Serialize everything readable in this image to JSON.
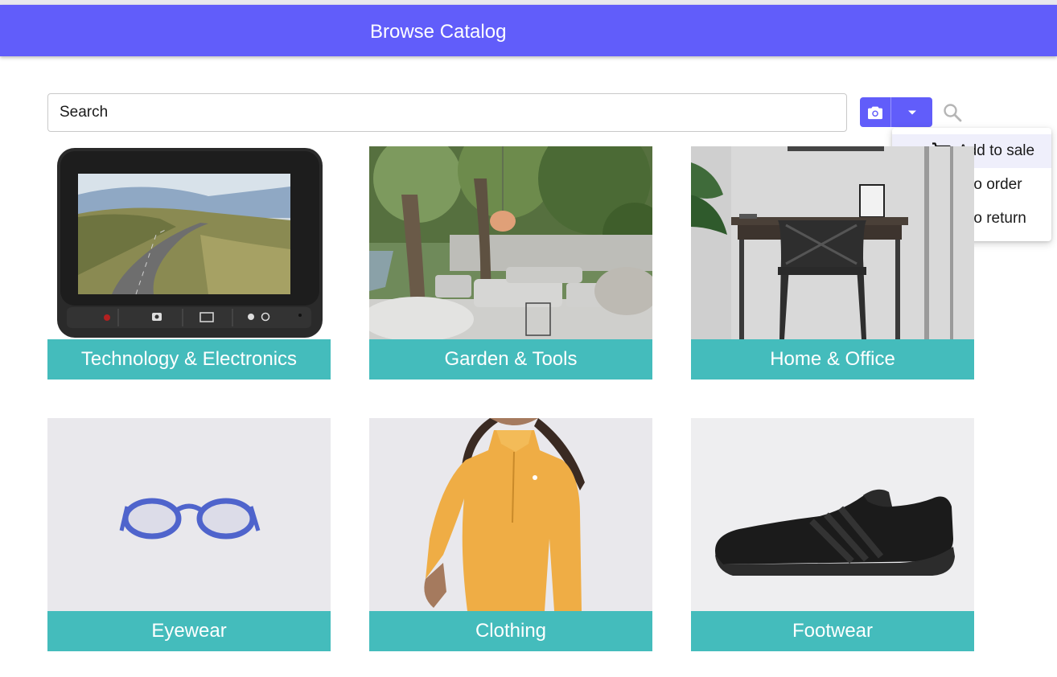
{
  "header": {
    "title": "Browse Catalog"
  },
  "search": {
    "placeholder": "Search"
  },
  "actions_menu": {
    "items": [
      {
        "label": "Add to sale",
        "icon": "cart-icon",
        "selected": true
      },
      {
        "label": "Add to order",
        "icon": "truck-icon",
        "selected": false
      },
      {
        "label": "Add to return",
        "icon": "refresh-icon",
        "selected": false
      }
    ]
  },
  "categories": [
    {
      "label": "Technology & Electronics",
      "image": "dash-camera-image"
    },
    {
      "label": "Garden & Tools",
      "image": "patio-furniture-image"
    },
    {
      "label": "Home & Office",
      "image": "desk-chair-image"
    },
    {
      "label": "Eyewear",
      "image": "glasses-image"
    },
    {
      "label": "Clothing",
      "image": "yellow-top-image"
    },
    {
      "label": "Footwear",
      "image": "black-sneaker-image"
    }
  ],
  "colors": {
    "primary": "#615dfa",
    "teal": "#44bcbc",
    "check": "#2e7d32"
  }
}
